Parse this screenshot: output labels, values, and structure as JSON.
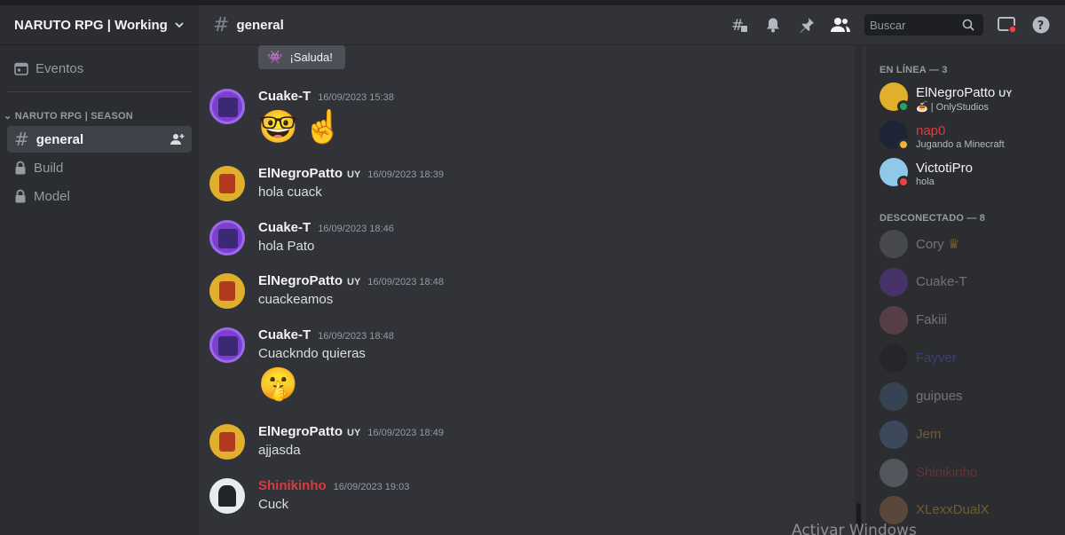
{
  "guild": {
    "name": "NARUTO RPG | Working"
  },
  "channel": {
    "name": "general"
  },
  "header": {
    "search_placeholder": "Buscar"
  },
  "sidebar": {
    "events_label": "Eventos",
    "category": "NARUTO RPG | SEASON",
    "channels": [
      {
        "label": "general",
        "icon": "hash-icon",
        "active": true
      },
      {
        "label": "Build",
        "icon": "lock-icon"
      },
      {
        "label": "Model",
        "icon": "lock-icon"
      }
    ]
  },
  "reaction": {
    "label": "¡Saluda!"
  },
  "messages": [
    {
      "author": "Cuake-T",
      "tag": "",
      "timestamp": "16/09/2023 15:38",
      "text": "",
      "emojis": [
        "🤓",
        "☝️"
      ],
      "color": "#f2f3f5"
    },
    {
      "author": "ElNegroPatto",
      "tag": "UY",
      "timestamp": "16/09/2023 18:39",
      "text": "hola cuack",
      "color": "#f2f3f5"
    },
    {
      "author": "Cuake-T",
      "tag": "",
      "timestamp": "16/09/2023 18:46",
      "text": "hola Pato",
      "color": "#f2f3f5"
    },
    {
      "author": "ElNegroPatto",
      "tag": "UY",
      "timestamp": "16/09/2023 18:48",
      "text": "cuackeamos",
      "color": "#f2f3f5"
    },
    {
      "author": "Cuake-T",
      "tag": "",
      "timestamp": "16/09/2023 18:48",
      "text": "Cuackndo quieras",
      "emojis": [
        "🤫"
      ],
      "color": "#f2f3f5"
    },
    {
      "author": "ElNegroPatto",
      "tag": "UY",
      "timestamp": "16/09/2023 18:49",
      "text": "ajjasda",
      "color": "#f2f3f5"
    },
    {
      "author": "Shinikinho",
      "tag": "",
      "timestamp": "16/09/2023 19:03",
      "text": "Cuck",
      "color": "#d83c3e"
    }
  ],
  "members": {
    "online_header": "EN LÍNEA — 3",
    "offline_header": "DESCONECTADO — 8",
    "online": [
      {
        "name": "ElNegroPatto",
        "tag": "UY",
        "activity": "🍝 | OnlyStudios",
        "status_color": "#23a55a",
        "name_color": "#f2f3f5",
        "avatar_color": "#e0b02c"
      },
      {
        "name": "nap0",
        "tag": "",
        "activity": "Jugando a Minecraft",
        "status_color": "#f0b232",
        "name_color": "#d83c3e",
        "avatar_color": "#1d2438"
      },
      {
        "name": "VictotiPro",
        "tag": "",
        "activity": "hola",
        "status_color": "#f23f43",
        "name_color": "#f2f3f5",
        "avatar_color": "#8fc8e8"
      }
    ],
    "offline": [
      {
        "name": "Cory",
        "crown": "♛",
        "name_color": "#f2f3f5",
        "avatar_color": "#7a7f87"
      },
      {
        "name": "Cuake-T",
        "name_color": "#f2f3f5",
        "avatar_color": "#7d3fd1"
      },
      {
        "name": "Fakiii",
        "name_color": "#f2f3f5",
        "avatar_color": "#a3616a"
      },
      {
        "name": "Fayver",
        "name_color": "#5865f2",
        "avatar_color": "#1a1b1e"
      },
      {
        "name": "guipues",
        "name_color": "#f2f3f5",
        "avatar_color": "#4c6d8c"
      },
      {
        "name": "Jem",
        "name_color": "#f0b232",
        "avatar_color": "#5a7fa8"
      },
      {
        "name": "Shinikinho",
        "name_color": "#d83c3e",
        "avatar_color": "#9aa4b1"
      },
      {
        "name": "XLexxDualX",
        "name_color": "#f0b232",
        "avatar_color": "#b07a4c"
      }
    ]
  },
  "watermark": "Activar Windows"
}
